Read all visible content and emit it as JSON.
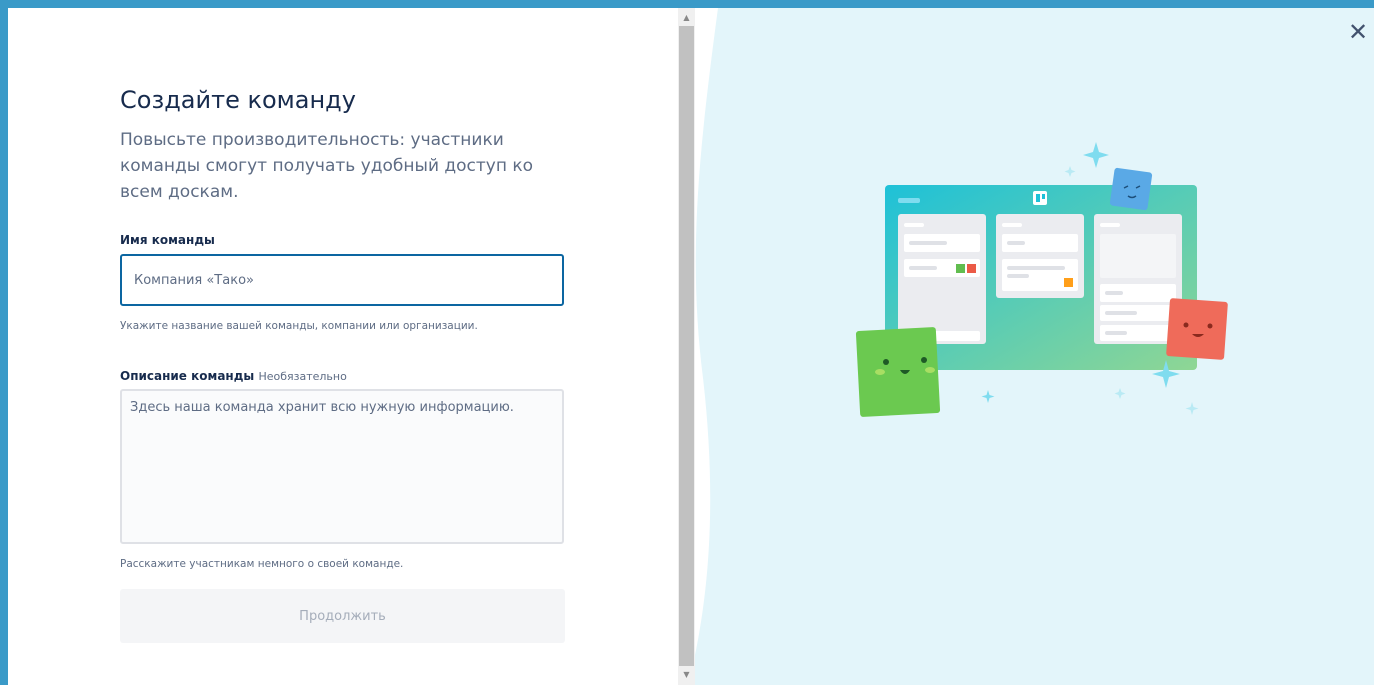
{
  "dialog": {
    "title": "Создайте команду",
    "subtitle": "Повысьте производительность: участники команды смогут получать удобный доступ ко всем доскам.",
    "name_field": {
      "label": "Имя команды",
      "placeholder": "Компания «Тако»",
      "hint": "Укажите название вашей команды, компании или организации."
    },
    "description_field": {
      "label": "Описание команды",
      "optional_label": "Необязательно",
      "placeholder": "Здесь наша команда хранит всю нужную информацию.",
      "hint": "Расскажите участникам немного о своей команде."
    },
    "continue_label": "Продолжить",
    "close_icon": "close-icon"
  },
  "illustration": {
    "name": "team-board-illustration",
    "colors": {
      "board_gradient_start": "#1ec1d8",
      "board_gradient_end": "#8fd694",
      "green_card": "#6bc950",
      "red_card": "#ef6b5a",
      "blue_card": "#5aa9e6",
      "sparkle": "#7fdcef"
    }
  },
  "colors": {
    "page_background": "#3a9ac8",
    "panel_background": "#ffffff",
    "illustration_background": "#e3f5fa",
    "input_focus_border": "#0c66a1",
    "title_text": "#172b4d",
    "muted_text": "#5e6c84"
  }
}
